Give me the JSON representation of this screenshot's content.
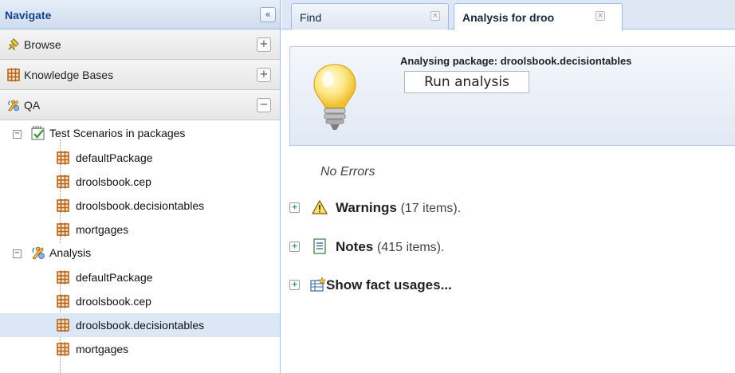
{
  "navigate": {
    "title": "Navigate",
    "collapse_glyph": "«",
    "sections": [
      {
        "label": "Browse",
        "icon": "browse-icon",
        "button": "+"
      },
      {
        "label": "Knowledge Bases",
        "icon": "package-icon",
        "button": "+"
      },
      {
        "label": "QA",
        "icon": "qa-icon",
        "button": "−"
      }
    ],
    "tree": {
      "test_scenarios": {
        "label": "Test Scenarios in packages",
        "toggle": "−",
        "items": [
          "defaultPackage",
          "droolsbook.cep",
          "droolsbook.decisiontables",
          "mortgages"
        ]
      },
      "analysis": {
        "label": "Analysis",
        "toggle": "−",
        "items": [
          "defaultPackage",
          "droolsbook.cep",
          "droolsbook.decisiontables",
          "mortgages"
        ],
        "selected_index": 2
      }
    }
  },
  "tabs": [
    {
      "label": "Find",
      "close": "×",
      "active": false
    },
    {
      "label": "Analysis for droo",
      "close": "×",
      "active": true
    }
  ],
  "analysis_panel": {
    "package_text": "Analysing package: droolsbook.decisiontables",
    "run_button": "Run analysis"
  },
  "results": {
    "no_errors": "No Errors",
    "warnings": {
      "label": "Warnings",
      "count": "(17 items)."
    },
    "notes": {
      "label": "Notes",
      "count": "(415 items)."
    },
    "fact_usages": {
      "label": "Show fact usages..."
    },
    "expand_glyph": "+"
  },
  "colors": {
    "accent_border": "#99bbe8",
    "header_text": "#15428b",
    "package_icon": "#b5651d",
    "selected_row": "#dce7f6"
  }
}
